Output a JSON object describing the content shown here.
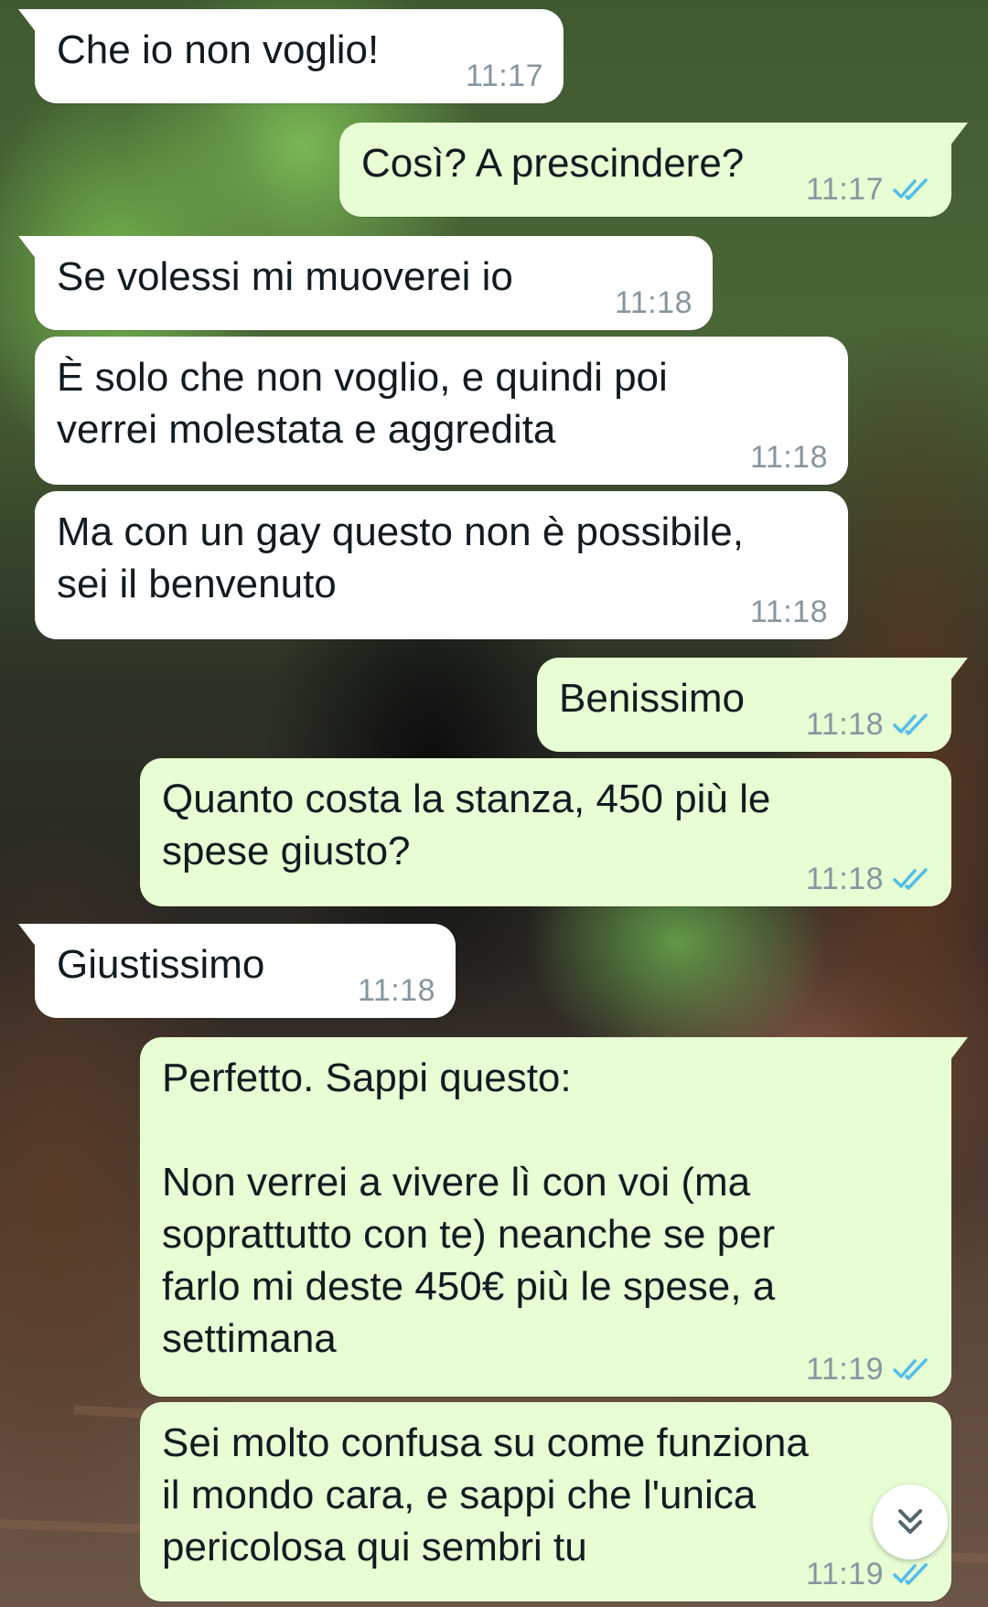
{
  "chat": {
    "messages": [
      {
        "dir": "in",
        "text": "Che io non voglio!",
        "time": "11:17"
      },
      {
        "dir": "out",
        "text": "Così? A prescindere?",
        "time": "11:17",
        "status": "read"
      },
      {
        "dir": "in",
        "text": "Se volessi mi muoverei io",
        "time": "11:18"
      },
      {
        "dir": "in",
        "text": "È solo che non voglio, e quindi poi\nverrei molestata e aggredita",
        "time": "11:18"
      },
      {
        "dir": "in",
        "text": "Ma con un gay questo non è possibile,\nsei il benvenuto",
        "time": "11:18"
      },
      {
        "dir": "out",
        "text": "Benissimo",
        "time": "11:18",
        "status": "read"
      },
      {
        "dir": "out",
        "text": "Quanto costa la stanza, 450 più le\nspese giusto?",
        "time": "11:18",
        "status": "read"
      },
      {
        "dir": "in",
        "text": "Giustissimo",
        "time": "11:18"
      },
      {
        "dir": "out",
        "text": "Perfetto. Sappi questo:\n\nNon verrei a vivere lì con voi (ma\nsoprattutto con te) neanche se per\nfarlo mi deste 450€ più le spese, a\nsettimana",
        "time": "11:19",
        "status": "read"
      },
      {
        "dir": "out",
        "text": "Sei molto confusa su come funziona\nil mondo cara, e sappi che l'unica\npericolosa qui sembri tu",
        "time": "11:19",
        "status": "read"
      }
    ]
  },
  "icons": {
    "read_ticks": "double-check-icon",
    "scroll_down": "double-chevron-down-icon"
  },
  "colors": {
    "incoming_bubble": "#ffffff",
    "outgoing_bubble": "#e7fdd3",
    "read_tick": "#53bdeb",
    "timestamp": "#8696a0",
    "text": "#111b21"
  }
}
